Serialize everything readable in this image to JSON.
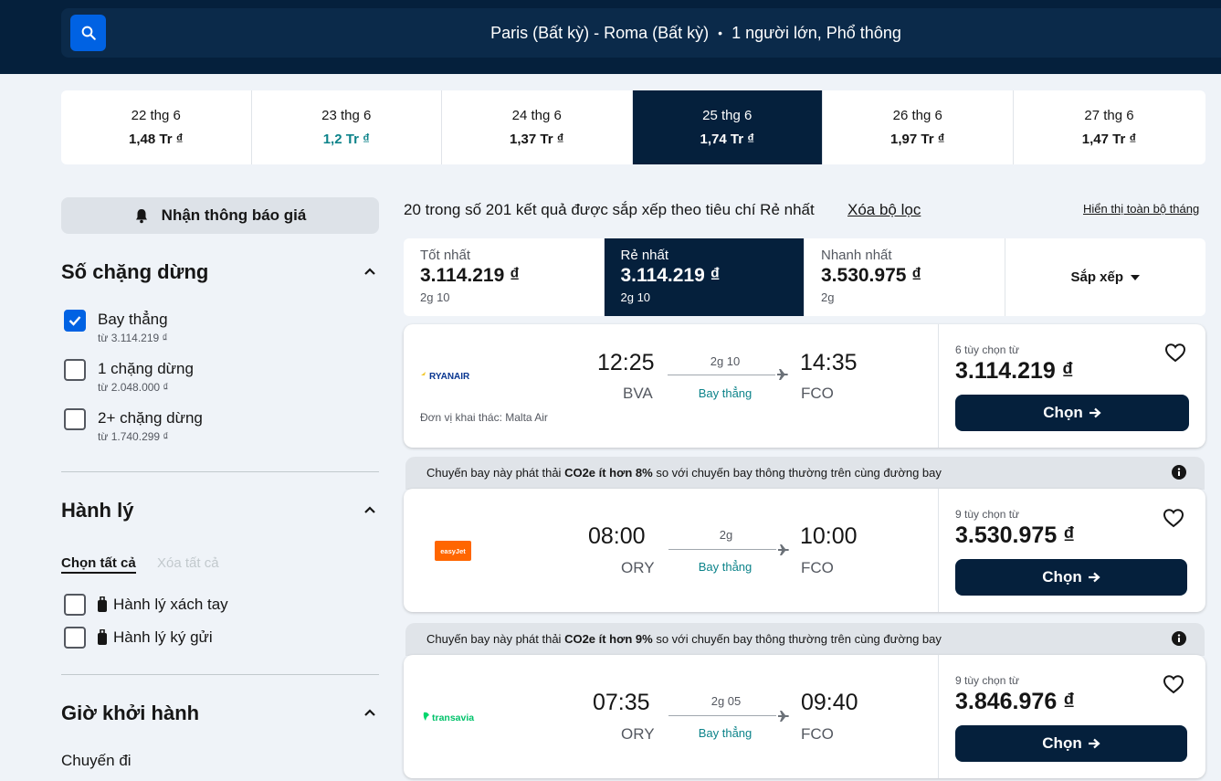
{
  "search": {
    "route": "Paris (Bất kỳ) - Roma (Bất kỳ)",
    "passengers": "1 người lớn, Phổ thông"
  },
  "dates": [
    {
      "date": "22 thg 6",
      "price": "1,48 Tr ₫"
    },
    {
      "date": "23 thg 6",
      "price": "1,2 Tr ₫"
    },
    {
      "date": "24 thg 6",
      "price": "1,37 Tr ₫"
    },
    {
      "date": "25 thg 6",
      "price": "1,74 Tr ₫"
    },
    {
      "date": "26 thg 6",
      "price": "1,97 Tr ₫"
    },
    {
      "date": "27 thg 6",
      "price": "1,47 Tr ₫"
    }
  ],
  "sidebar": {
    "price_alert": "Nhận thông báo giá",
    "stops_title": "Số chặng dừng",
    "stops": [
      {
        "label": "Bay thẳng",
        "sub": "từ 3.114.219 ₫",
        "checked": true
      },
      {
        "label": "1 chặng dừng",
        "sub": "từ 2.048.000 ₫",
        "checked": false
      },
      {
        "label": "2+ chặng dừng",
        "sub": "từ 1.740.299 ₫",
        "checked": false
      }
    ],
    "baggage_title": "Hành lý",
    "select_all": "Chọn tất cả",
    "clear_all": "Xóa tất cả",
    "bags": [
      {
        "label": "Hành lý xách tay"
      },
      {
        "label": "Hành lý ký gửi"
      }
    ],
    "departure_title": "Giờ khởi hành",
    "outbound": "Chuyến đi"
  },
  "results": {
    "info": "20 trong số 201 kết quả được sắp xếp theo tiêu chí Rẻ nhất",
    "clear_filters": "Xóa bộ lọc",
    "show_month": "Hiển thị toàn bộ tháng"
  },
  "sort": {
    "tabs": [
      {
        "label": "Tốt nhất",
        "price": "3.114.219 ₫",
        "duration": "2g 10"
      },
      {
        "label": "Rẻ nhất",
        "price": "3.114.219 ₫",
        "duration": "2g 10"
      },
      {
        "label": "Nhanh nhất",
        "price": "3.530.975 ₫",
        "duration": "2g"
      }
    ],
    "sort_label": "Sắp xếp"
  },
  "flights": [
    {
      "airline": "RYANAIR",
      "dep_time": "12:25",
      "dep_apt": "BVA",
      "arr_time": "14:35",
      "arr_apt": "FCO",
      "duration": "2g 10",
      "stops": "Bay thẳng",
      "operator": "Đơn vị khai thác: Malta Air",
      "options": "6 tùy chọn từ",
      "price": "3.114.219 ₫",
      "select": "Chọn"
    },
    {
      "banner_pre": "Chuyến bay này phát thải ",
      "banner_bold": "CO2e ít hơn 8%",
      "banner_post": " so với chuyến bay thông thường trên cùng đường bay",
      "airline": "easyJet",
      "dep_time": "08:00",
      "dep_apt": "ORY",
      "arr_time": "10:00",
      "arr_apt": "FCO",
      "duration": "2g",
      "stops": "Bay thẳng",
      "options": "9 tùy chọn từ",
      "price": "3.530.975 ₫",
      "select": "Chọn"
    },
    {
      "banner_pre": "Chuyến bay này phát thải ",
      "banner_bold": "CO2e ít hơn 9%",
      "banner_post": " so với chuyến bay thông thường trên cùng đường bay",
      "airline": "transavia",
      "dep_time": "07:35",
      "dep_apt": "ORY",
      "arr_time": "09:40",
      "arr_apt": "FCO",
      "duration": "2g 05",
      "stops": "Bay thẳng",
      "options": "9 tùy chọn từ",
      "price": "3.846.976 ₫",
      "select": "Chọn"
    }
  ],
  "colors": {
    "navy": "#05203c",
    "blue": "#0062e3",
    "teal": "#0c838a",
    "easyjet": "#ff6600",
    "transavia": "#00d66c",
    "ryanair_yellow": "#f1c933"
  }
}
